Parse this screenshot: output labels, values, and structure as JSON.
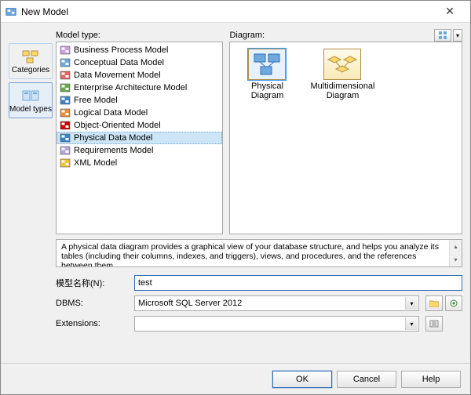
{
  "window": {
    "title": "New Model"
  },
  "rail": {
    "categories": "Categories",
    "model_types": "Model types"
  },
  "headers": {
    "model_type": "Model type:",
    "diagram": "Diagram:"
  },
  "model_types": [
    {
      "label": "Business Process Model"
    },
    {
      "label": "Conceptual Data Model"
    },
    {
      "label": "Data Movement Model"
    },
    {
      "label": "Enterprise Architecture Model"
    },
    {
      "label": "Free Model"
    },
    {
      "label": "Logical Data Model"
    },
    {
      "label": "Object-Oriented Model"
    },
    {
      "label": "Physical Data Model"
    },
    {
      "label": "Requirements Model"
    },
    {
      "label": "XML Model"
    }
  ],
  "selected_model_type_index": 7,
  "diagrams": [
    {
      "label": "Physical Diagram"
    },
    {
      "label": "Multidimensional Diagram"
    }
  ],
  "selected_diagram_index": 0,
  "description": "A physical data diagram provides a graphical view of your database structure, and helps you analyze its tables (including their columns, indexes, and triggers), views, and procedures, and the references between them.",
  "form": {
    "name_label": "模型名称(N):",
    "name_value": "test",
    "dbms_label": "DBMS:",
    "dbms_value": "Microsoft SQL Server 2012",
    "ext_label": "Extensions:",
    "ext_value": ""
  },
  "buttons": {
    "ok": "OK",
    "cancel": "Cancel",
    "help": "Help"
  }
}
